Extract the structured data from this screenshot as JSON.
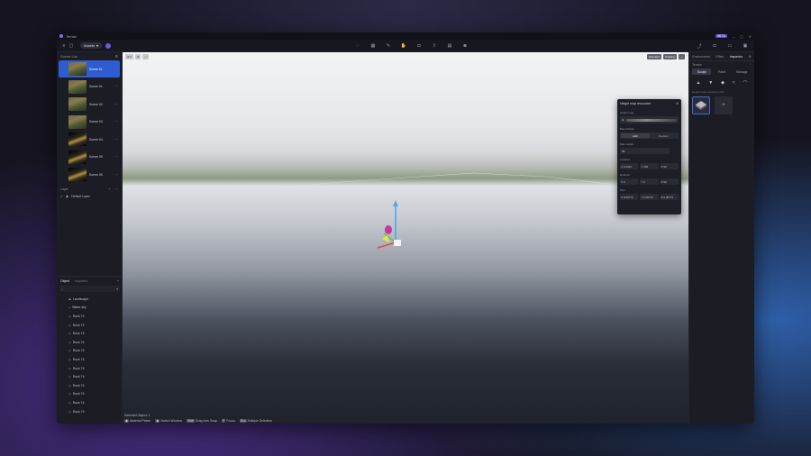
{
  "window": {
    "title": "Terrain"
  },
  "titlebar": {
    "beta_badge": "BETA",
    "minimize": "–",
    "maximize": "◻",
    "close": "✕"
  },
  "toolbar": {
    "workspace_pill": "Assets",
    "center_icons": [
      "light-icon",
      "grid-icon",
      "brush-icon",
      "hand-icon",
      "camera-icon",
      "export-icon",
      "layers-icon",
      "vr-icon"
    ],
    "right_icons": [
      "share-icon",
      "camera-icon",
      "layout-icon",
      "screen-icon"
    ]
  },
  "scenes": {
    "header": "Scene List",
    "items": [
      {
        "label": "Scene 01",
        "action": "⋯",
        "dark": false
      },
      {
        "label": "Scene 01",
        "action": "⋯",
        "dark": false
      },
      {
        "label": "Scene 02",
        "action": "⋯",
        "dark": false
      },
      {
        "label": "Scene 03",
        "action": "⋯",
        "dark": false
      },
      {
        "label": "Scene 04",
        "action": "⋯",
        "dark": true
      },
      {
        "label": "Scene 05",
        "action": "⋯",
        "dark": true
      },
      {
        "label": "Scene 06",
        "action": "⋯",
        "dark": true
      }
    ]
  },
  "layers": {
    "header": "Layer",
    "add": "+",
    "more": "⋯",
    "items": [
      {
        "label": "Default Layer"
      }
    ]
  },
  "objects": {
    "tab_object": "Object",
    "tab_imported": "Imported",
    "add": "+",
    "search_placeholder": "",
    "items": [
      {
        "label": "Landscape",
        "icon": "landscape"
      },
      {
        "label": "Water-sky",
        "icon": "water"
      },
      {
        "label": "Rock 74",
        "icon": "rock"
      },
      {
        "label": "Rock 74",
        "icon": "rock"
      },
      {
        "label": "Rock 74",
        "icon": "rock"
      },
      {
        "label": "Rock 74",
        "icon": "rock"
      },
      {
        "label": "Rock 74",
        "icon": "rock"
      },
      {
        "label": "Rock 74",
        "icon": "rock"
      },
      {
        "label": "Rock 74",
        "icon": "rock"
      },
      {
        "label": "Rock 74",
        "icon": "rock"
      },
      {
        "label": "Rock 74",
        "icon": "rock"
      },
      {
        "label": "Rock 74",
        "icon": "rock"
      },
      {
        "label": "Rock 74",
        "icon": "rock"
      },
      {
        "label": "Rock 74",
        "icon": "rock"
      }
    ]
  },
  "viewport": {
    "left_chips": [
      "⊕ ▾",
      "⊞",
      "⤢"
    ],
    "right_chips": [
      "Standard",
      "Shading",
      "⋯"
    ],
    "status": "Selected Object: 1",
    "hints": [
      {
        "key": "◉",
        "label": "Material Picker"
      },
      {
        "key": "◉",
        "label": "Switch Window"
      },
      {
        "key": "Shift",
        "label": "Drag Axis Snap"
      },
      {
        "key": "F",
        "label": "Focus"
      },
      {
        "key": "Esc",
        "label": "Multiple Selection"
      }
    ]
  },
  "dialog": {
    "title": "Height map resources",
    "close": "✕",
    "image_label": "Height map",
    "image_value": "⊕",
    "blend_label": "Blend Mode",
    "blend_add": "Add",
    "blend_replace": "Replace",
    "height_label": "Max Height",
    "height_value": "30",
    "location_label": "Location",
    "location": {
      "x": "X 0.0422",
      "y": "Y 166",
      "z": "Z 93"
    },
    "rotation_label": "Rotation",
    "rotation": {
      "x": "X 0",
      "y": "Y 0",
      "z": "Z 90"
    },
    "size_label": "Size",
    "size": {
      "x": "X 0.00772",
      "y": "Y 0.00772",
      "z": "Z 0.00772"
    }
  },
  "right_panel": {
    "tabs": [
      "Environment",
      "Effect",
      "Inspector"
    ],
    "active_tab": "Inspector",
    "section": "Terrain",
    "modes": [
      "Sculpt",
      "Paint",
      "Manage"
    ],
    "active_mode": "Sculpt",
    "brushes": [
      "▲",
      "▼",
      "◆",
      "≈",
      "⌒"
    ],
    "asset_label": "Height map resources (25)",
    "add_asset": "+"
  }
}
